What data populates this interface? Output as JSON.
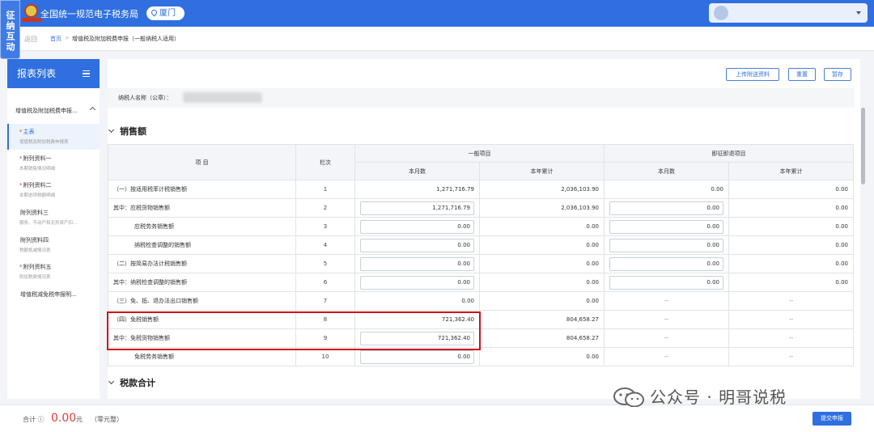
{
  "header": {
    "system_title": "全国统一规范电子税务局",
    "city": "厦门",
    "float_tab": "征纳互动"
  },
  "breadcrumb": {
    "back": "返回",
    "home": "首页",
    "separator": ">",
    "current": "增值税及附加税费申报（一般纳税人适用）"
  },
  "sidebar": {
    "title": "报表列表",
    "group": "增值税及附加税费申报...",
    "items": [
      {
        "required": "*",
        "label": "主表",
        "sub": "增值税及附加税费申报表",
        "active": true
      },
      {
        "required": "*",
        "label": "附列资料一",
        "sub": "本期销售情况明细"
      },
      {
        "required": "*",
        "label": "附列资料二",
        "sub": "本期进项税额明细"
      },
      {
        "required": "",
        "label": "附列资料三",
        "sub": "服务、不动产和无形资产扣..."
      },
      {
        "required": "",
        "label": "附列资料四",
        "sub": "税额抵减情况表"
      },
      {
        "required": "*",
        "label": "附列资料五",
        "sub": "附加税费情况表"
      },
      {
        "required": "",
        "label": "增值税减免税申报明...",
        "sub": ""
      }
    ]
  },
  "toolbar": {
    "upload": "上传附送资料",
    "reset": "重置",
    "save": "暂存"
  },
  "taxpayer": {
    "label": "纳税人名称（公章）："
  },
  "sections": {
    "sales": "销售额",
    "tax_total": "税款合计"
  },
  "table": {
    "headers": {
      "item": "项 目",
      "column_no": "栏次",
      "general": "一般项目",
      "immediate_refund": "即征即退项目",
      "this_month": "本月数",
      "year_to_date": "本年累计"
    },
    "rows": [
      {
        "item": "（一）按适用税率计税销售额",
        "no": "1",
        "gen_month": "1,271,716.79",
        "gen_ytd": "2,036,103.90",
        "imm_month": "0.00",
        "imm_ytd": "0.00"
      },
      {
        "item": "其中：应税货物销售额",
        "no": "2",
        "gen_month": "1,271,716.79",
        "gen_ytd": "2,036,103.90",
        "imm_month": "0.00",
        "imm_ytd": "0.00"
      },
      {
        "item": "应税劳务销售额",
        "no": "3",
        "gen_month": "0.00",
        "gen_ytd": "0.00",
        "imm_month": "0.00",
        "imm_ytd": "0.00"
      },
      {
        "item": "纳税检查调整的销售额",
        "no": "4",
        "gen_month": "0.00",
        "gen_ytd": "0.00",
        "imm_month": "0.00",
        "imm_ytd": "0.00"
      },
      {
        "item": "（二）按简易办法计税销售额",
        "no": "5",
        "gen_month": "0.00",
        "gen_ytd": "0.00",
        "imm_month": "0.00",
        "imm_ytd": "0.00"
      },
      {
        "item": "其中：纳税检查调整的销售额",
        "no": "6",
        "gen_month": "0.00",
        "gen_ytd": "0.00",
        "imm_month": "0.00",
        "imm_ytd": "0.00"
      },
      {
        "item": "（三）免、抵、退办法出口销售额",
        "no": "7",
        "gen_month": "0.00",
        "gen_ytd": "0.00",
        "imm_month": "--",
        "imm_ytd": "--"
      },
      {
        "item": "（四）免税销售额",
        "no": "8",
        "gen_month": "721,362.40",
        "gen_ytd": "804,658.27",
        "imm_month": "--",
        "imm_ytd": "--"
      },
      {
        "item": "其中：免税货物销售额",
        "no": "9",
        "gen_month": "721,362.40",
        "gen_ytd": "804,658.27",
        "imm_month": "--",
        "imm_ytd": "--"
      },
      {
        "item": "免税劳务销售额",
        "no": "10",
        "gen_month": "0.00",
        "gen_ytd": "0.00",
        "imm_month": "--",
        "imm_ytd": "--"
      }
    ]
  },
  "footer": {
    "total_label": "合计 ⓘ",
    "total_value": "0.00",
    "unit": "元",
    "amount_cn": "（零元整）",
    "submit": "提交申报"
  },
  "watermark": {
    "text": "公众号 · 明哥说税"
  },
  "colors": {
    "primary": "#2f6fe0",
    "highlight": "#d0131c",
    "total": "#e03b3b"
  }
}
